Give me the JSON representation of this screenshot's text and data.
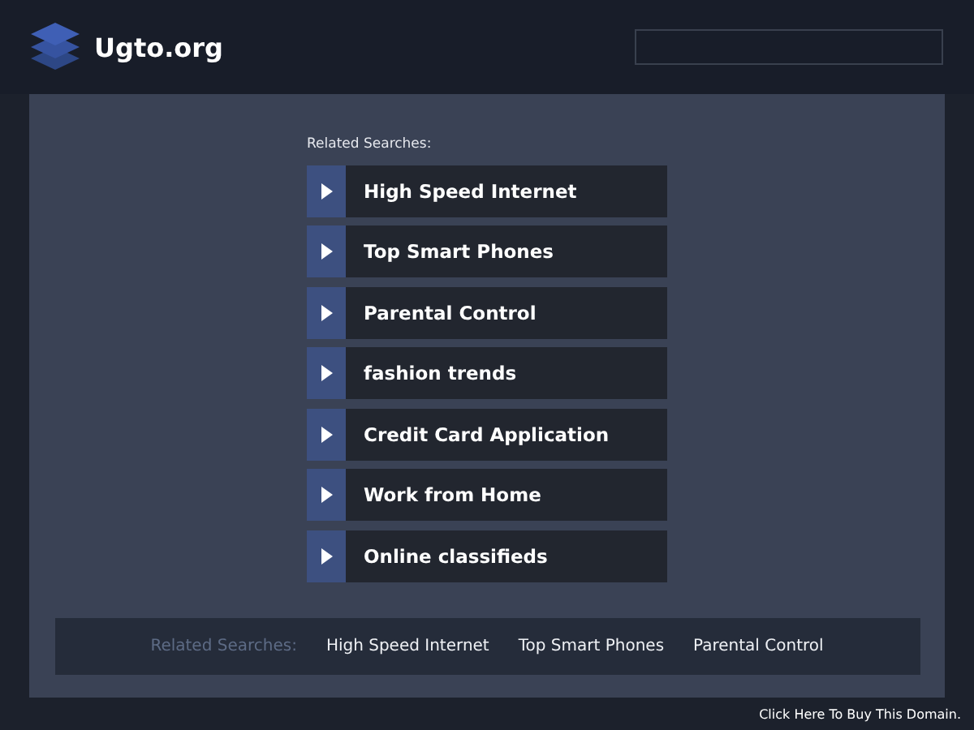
{
  "header": {
    "site_name": "Ugto.org"
  },
  "related": {
    "heading": "Related Searches:",
    "items": [
      "High Speed Internet",
      "Top Smart Phones",
      "Parental Control",
      "fashion trends",
      "Credit Card Application",
      "Work from Home",
      "Online classifieds"
    ]
  },
  "bottom_bar": {
    "heading": "Related Searches:",
    "links": [
      "High Speed Internet",
      "Top Smart Phones",
      "Parental Control"
    ]
  },
  "footer": {
    "link": "Click Here To Buy This Domain."
  }
}
